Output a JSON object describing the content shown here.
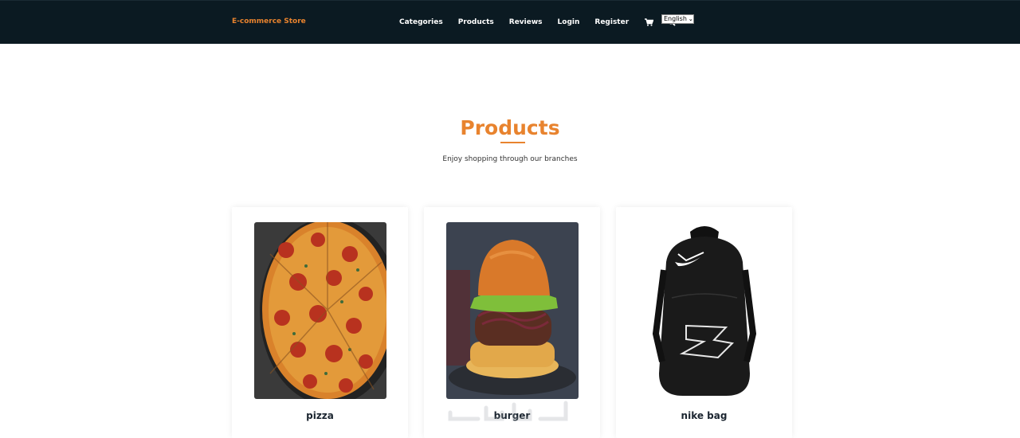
{
  "navbar": {
    "brand": "E-commerce Store",
    "links": [
      "Categories",
      "Products",
      "Reviews",
      "Login",
      "Register"
    ],
    "icons": [
      "cart-icon",
      "search-icon"
    ],
    "language_selected": "English"
  },
  "section": {
    "title": "Products",
    "subtitle": "Enjoy shopping through our branches"
  },
  "products": [
    {
      "name": "pizza"
    },
    {
      "name": "burger"
    },
    {
      "name": "nike bag"
    }
  ],
  "colors": {
    "navbar_bg": "#0b1a22",
    "accent": "#e8832e",
    "text_dark": "#1b2530"
  }
}
